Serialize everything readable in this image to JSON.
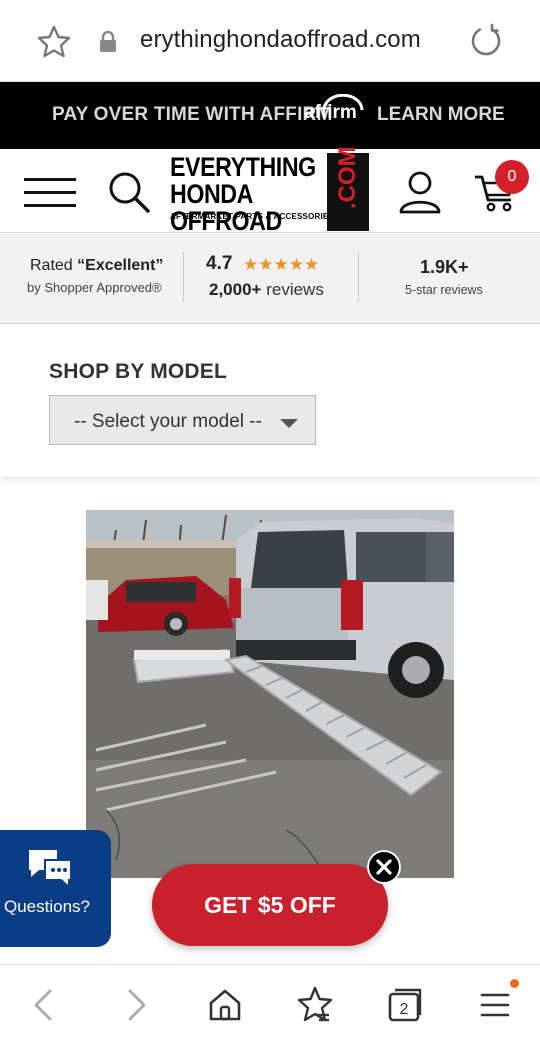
{
  "browser": {
    "url": "erythinghondaoffroad.com",
    "tab_count": "2"
  },
  "banner": {
    "pay_text": "PAY OVER TIME WITH AFFIRM",
    "affirm_logo": "affirm",
    "learn_more": "LEARN MORE"
  },
  "header": {
    "logo_line1": "EVERYTHING",
    "logo_line2": "HONDA OFFROAD",
    "logo_tagline": "AFTERMARKET PARTS & ACCESSORIES",
    "logo_com": ".COM",
    "cart_count": "0"
  },
  "rating": {
    "rated_prefix": "Rated ",
    "rated_value": "“Excellent”",
    "by": "by Shopper Approved®",
    "score": "4.7",
    "stars": "★★★★★",
    "reviews_count": "2,000+",
    "reviews_label": " reviews",
    "five_star_count": "1.9K+",
    "five_star_label": "5-star reviews"
  },
  "shop": {
    "title": "SHOP BY MODEL",
    "select_value": "-- Select your model --"
  },
  "floating": {
    "questions_label": "Questions?",
    "offer_label": "GET $5 OFF"
  },
  "colors": {
    "brand_red": "#c8202c",
    "chat_blue": "#0a3d86",
    "star_orange": "#e8932a",
    "banner_black": "#000000"
  }
}
